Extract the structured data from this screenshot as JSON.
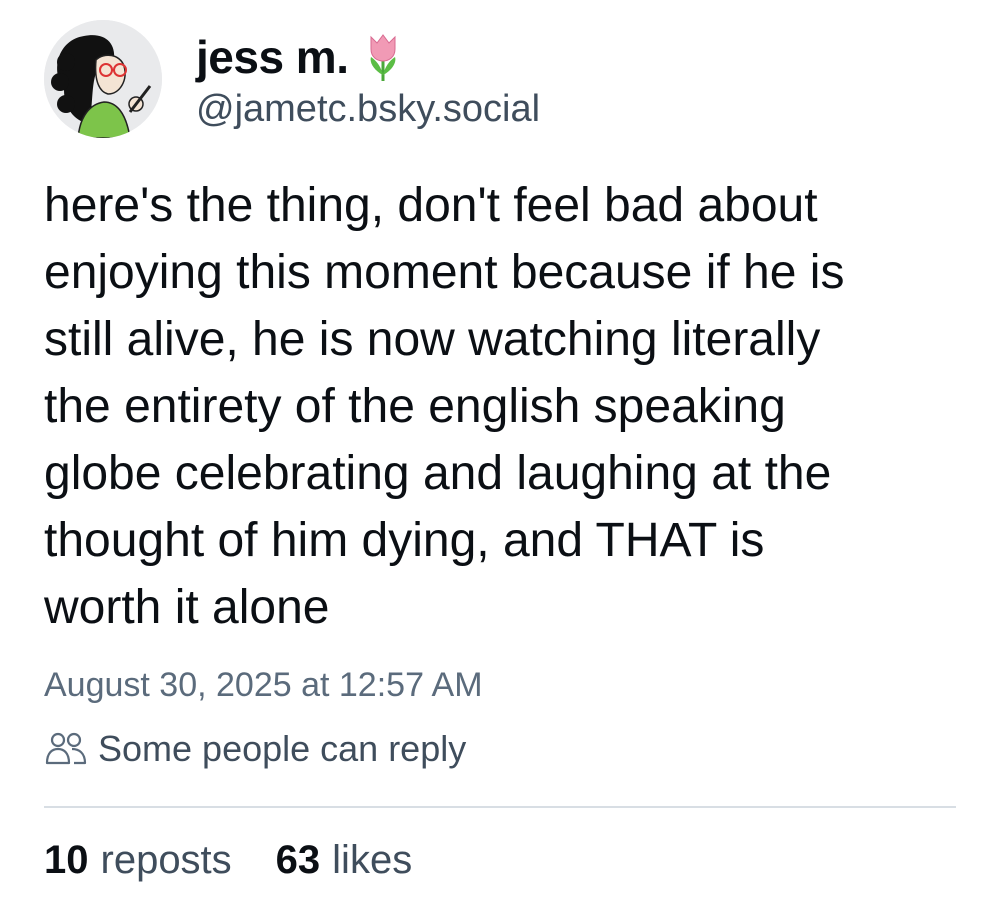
{
  "author": {
    "display_name": "jess m.",
    "emoji_icon": "tulip-icon",
    "handle": "@jametc.bsky.social",
    "avatar_icon": "avatar"
  },
  "post": {
    "text": "here's the thing, don't feel bad about\nenjoying this moment because if he is\nstill alive, he is now watching literally\nthe entirety of the english speaking\nglobe celebrating and laughing at the\nthought of him dying, and THAT is\nworth it alone",
    "timestamp": "August 30, 2025 at 12:57 AM",
    "reply_setting": "Some people can reply",
    "reply_icon": "people-icon"
  },
  "stats": {
    "reposts_count": "10",
    "reposts_label": "reposts",
    "likes_count": "63",
    "likes_label": "likes"
  },
  "colors": {
    "text": "#0b0f14",
    "secondary": "#3f4d5c",
    "muted": "#5b6b7c",
    "divider": "#d8dee4"
  }
}
